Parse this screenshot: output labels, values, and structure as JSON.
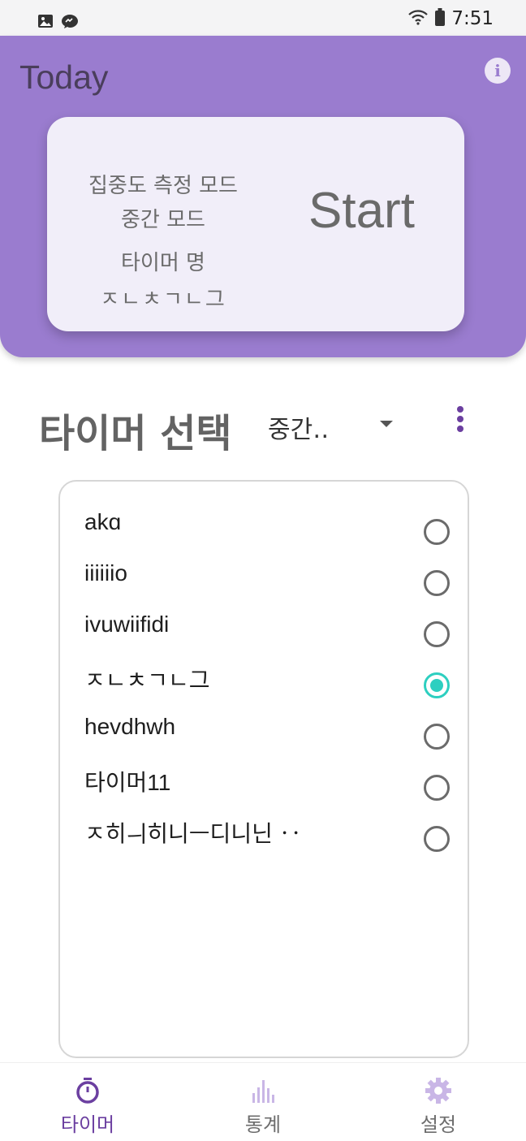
{
  "status_bar": {
    "time": "7:51",
    "left_icons": [
      "image-icon",
      "messenger-icon"
    ],
    "right_icons": [
      "wifi-icon",
      "battery-icon"
    ]
  },
  "header": {
    "title": "Today",
    "info_icon": "info-icon",
    "background_color": "#9a7ccf"
  },
  "start_card": {
    "mode_line1": "집중도 측정 모드",
    "mode_line2": "중간 모드",
    "timer_label": "타이머 명",
    "timer_name": "ㅈㄴㅊㄱㄴ그",
    "start_label": "Start"
  },
  "timer_select": {
    "title": "타이머 선택",
    "dropdown_value": "중간‥",
    "more_icon": "more-vert-icon"
  },
  "timers": [
    {
      "name": "akɑ",
      "selected": false
    },
    {
      "name": "iiiiiio",
      "selected": false
    },
    {
      "name": "ivuwiifidi",
      "selected": false
    },
    {
      "name": "ㅈㄴㅊㄱㄴ그",
      "selected": true
    },
    {
      "name": "hevdhwh",
      "selected": false
    },
    {
      "name": "타이머11",
      "selected": false
    },
    {
      "name": "ㅈ히ㅢ히니ㅡ디니닌 ‥",
      "selected": false
    }
  ],
  "bottom_nav": [
    {
      "label": "타이머",
      "icon": "timer-icon",
      "active": true
    },
    {
      "label": "통계",
      "icon": "stats-icon",
      "active": false
    },
    {
      "label": "설정",
      "icon": "settings-icon",
      "active": false
    }
  ],
  "colors": {
    "accent_purple": "#6b3fa0",
    "radio_selected": "#2dcfc0"
  }
}
